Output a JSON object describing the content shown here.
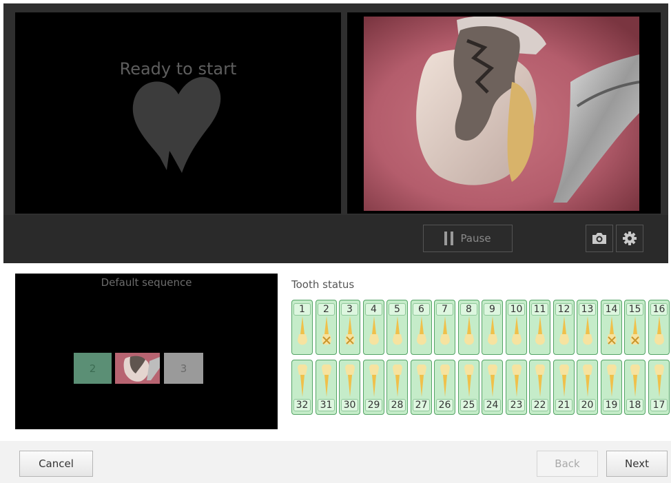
{
  "preview": {
    "status_text": "Ready to start"
  },
  "controls": {
    "pause_label": "Pause"
  },
  "sequence": {
    "title": "Default sequence",
    "items": [
      "2",
      "3"
    ]
  },
  "tooth_status": {
    "title": "Tooth status",
    "upper": [
      "1",
      "2",
      "3",
      "4",
      "5",
      "6",
      "7",
      "8",
      "9",
      "10",
      "11",
      "12",
      "13",
      "14",
      "15",
      "16"
    ],
    "lower": [
      "32",
      "31",
      "30",
      "29",
      "28",
      "27",
      "26",
      "25",
      "24",
      "23",
      "22",
      "21",
      "20",
      "19",
      "18",
      "17"
    ],
    "marked_teeth": [
      "2",
      "3",
      "14",
      "15"
    ]
  },
  "footer": {
    "cancel_label": "Cancel",
    "back_label": "Back",
    "next_label": "Next"
  },
  "colors": {
    "tooth_card_bg": "#c5ecc9",
    "tooth_card_border": "#53a365",
    "sequence_active": "#5b8f75",
    "sequence_pending": "#9a9a9a"
  },
  "icons": {
    "pause": "pause-icon",
    "camera": "camera-icon",
    "settings": "gear-icon",
    "logo": "tooth-logo-icon"
  }
}
